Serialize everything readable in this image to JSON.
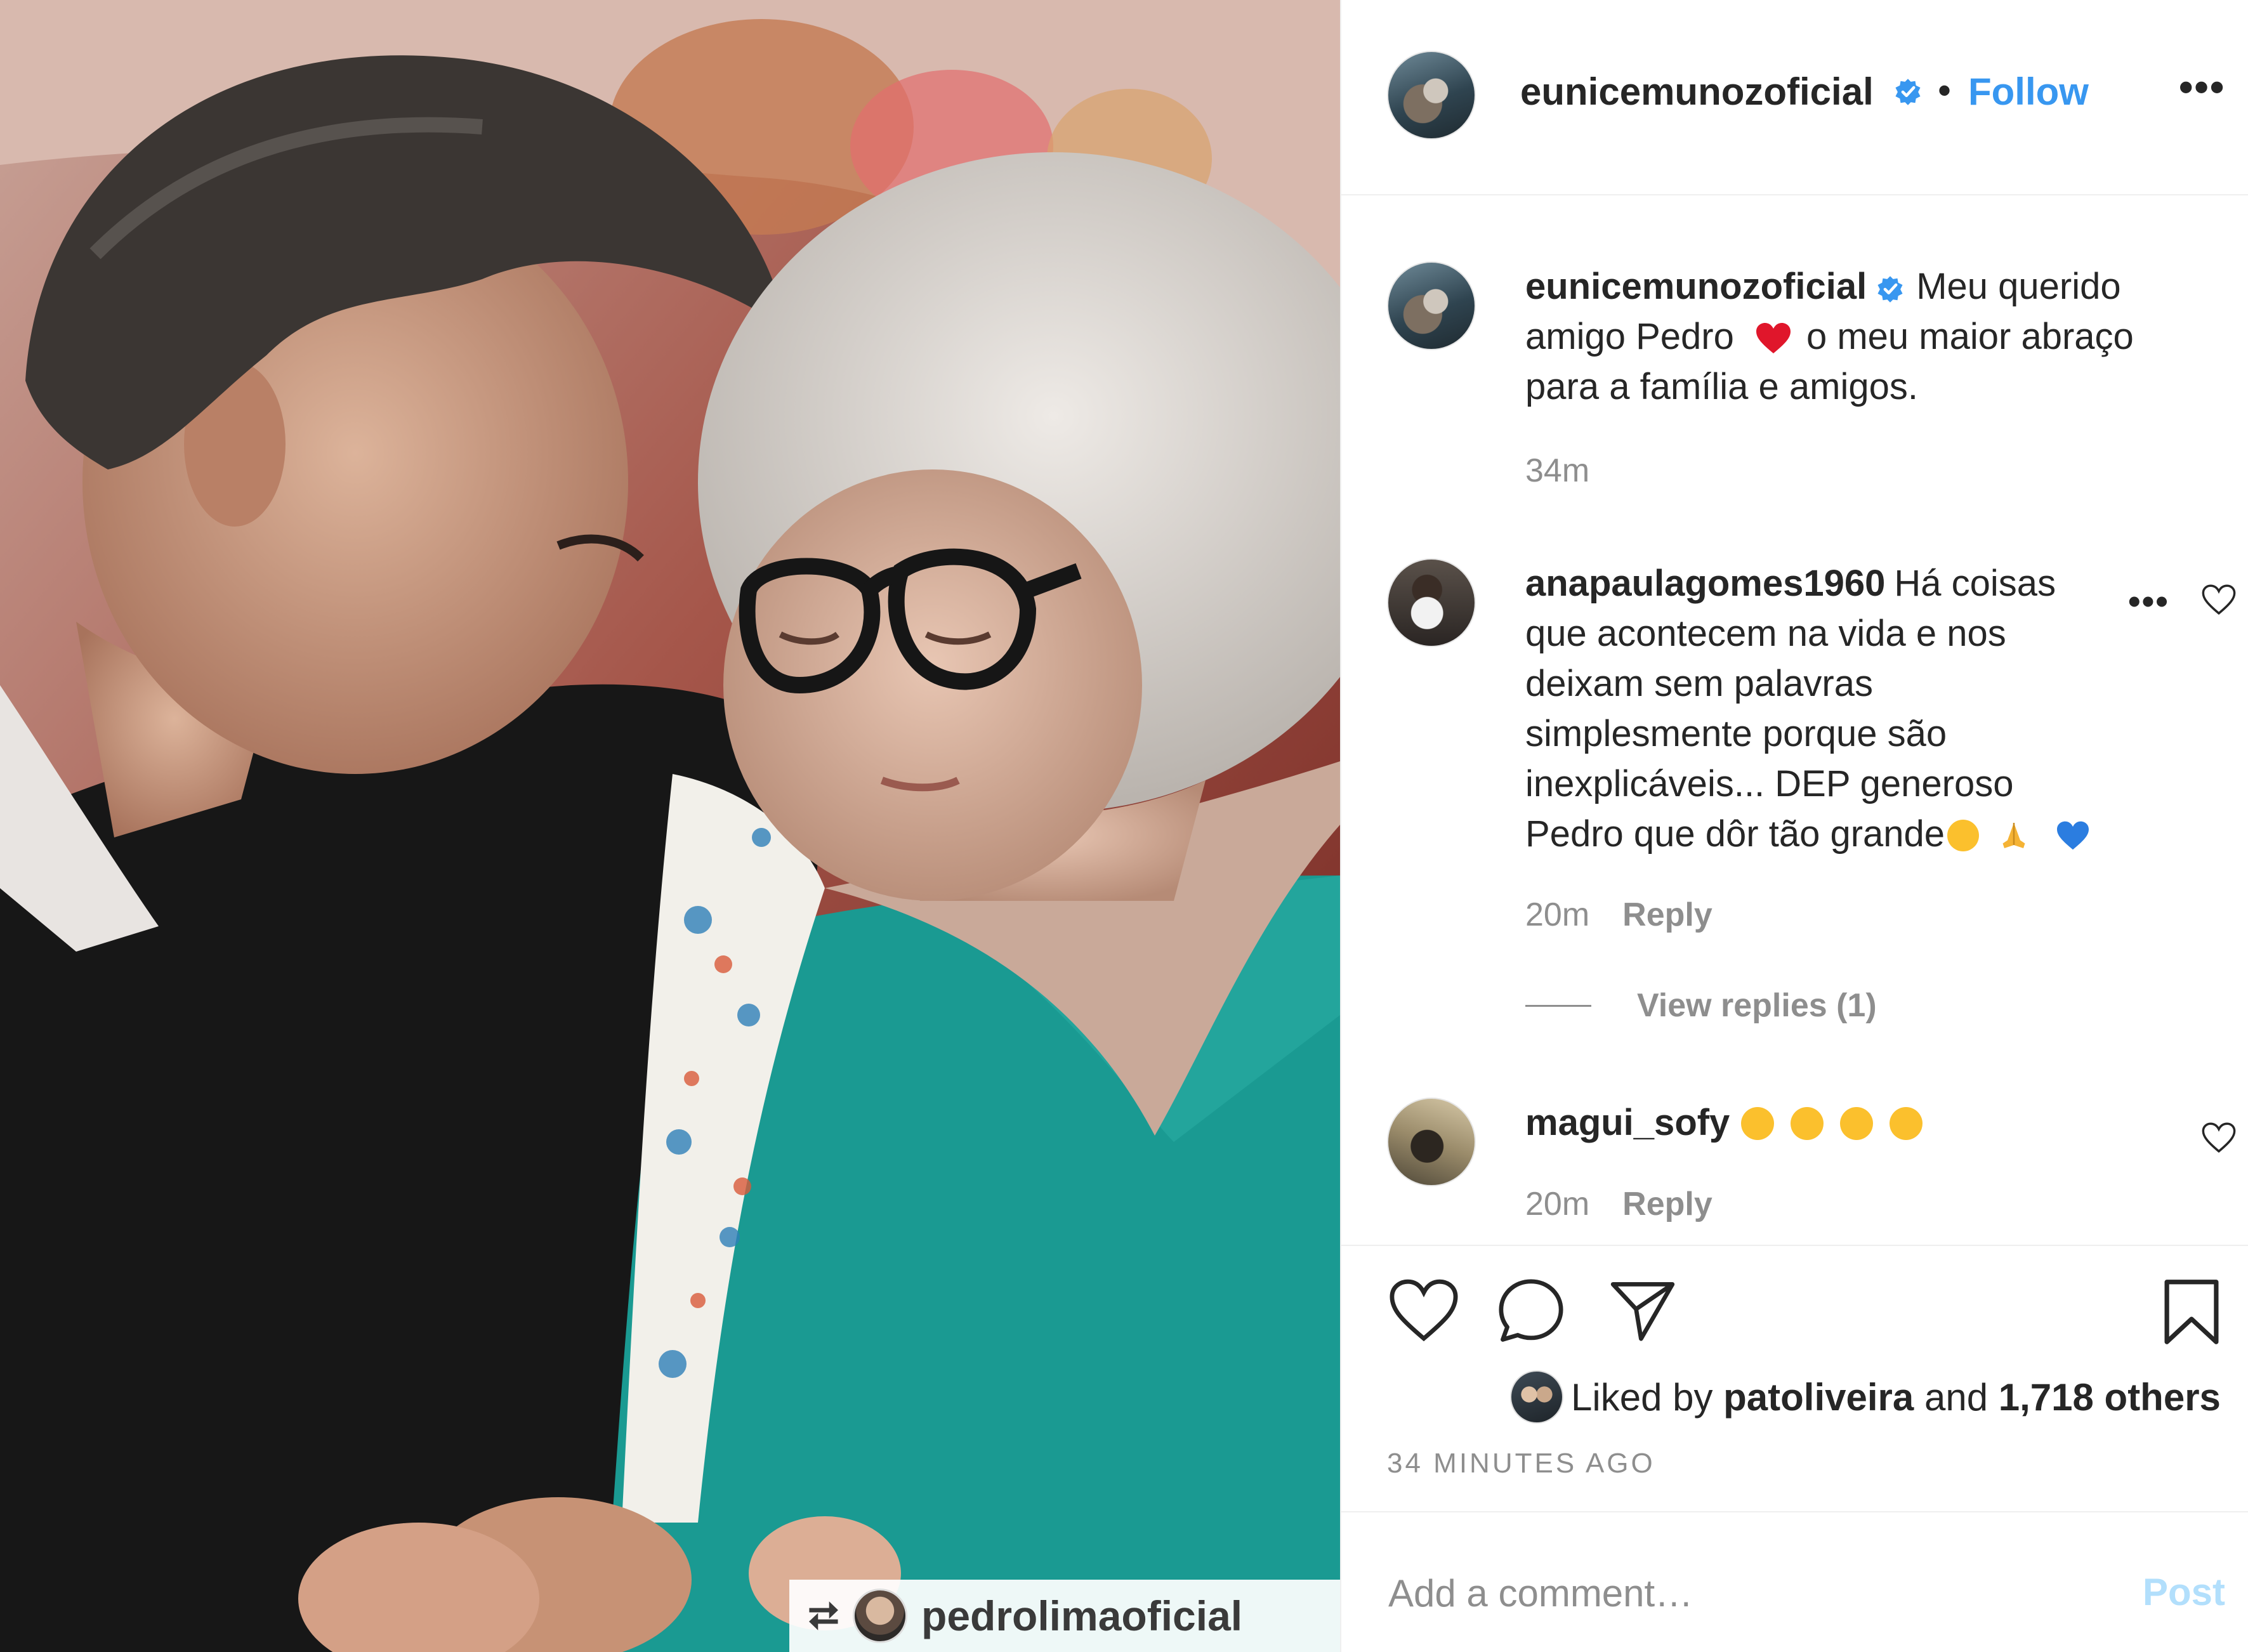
{
  "photo": {
    "repost_user": "pedrolimaoficial"
  },
  "header": {
    "username": "eunicemunozoficial",
    "dot": "•",
    "follow_label": "Follow",
    "more": "•••"
  },
  "caption": {
    "username": "eunicemunozoficial",
    "line1": "Meu querido",
    "line2_a": "amigo Pedro",
    "line2_b": "o meu maior abraço",
    "line3": "para a família e amigos.",
    "time": "34m"
  },
  "comments": [
    {
      "username": "anapaulagomes1960",
      "first": "Há coisas",
      "lines": [
        "que acontecem na vida e nos",
        "deixam sem palavras",
        "simplesmente porque são",
        "inexplicáveis... DEP generoso"
      ],
      "last": "Pedro que dôr tão grande",
      "time": "20m",
      "reply_label": "Reply",
      "more": "•••"
    },
    {
      "username": "magui_sofy",
      "time": "20m",
      "reply_label": "Reply"
    }
  ],
  "view_replies": "View replies (1)",
  "likes": {
    "prefix": "Liked by",
    "user": "patoliveira",
    "conj": "and",
    "others": "1,718 others"
  },
  "timestamp": "34 MINUTES AGO",
  "comment_box": {
    "placeholder": "Add a comment…",
    "post_label": "Post"
  },
  "colors": {
    "link_blue": "#3897f0",
    "muted": "#8e8e8e",
    "post_disabled": "#b2dffc",
    "heart_red": "#e0162b",
    "blue_heart": "#2b7de0"
  },
  "icons": [
    "verified-badge-icon",
    "heart-icon",
    "comment-icon",
    "share-icon",
    "bookmark-icon",
    "more-icon",
    "repost-icon"
  ]
}
